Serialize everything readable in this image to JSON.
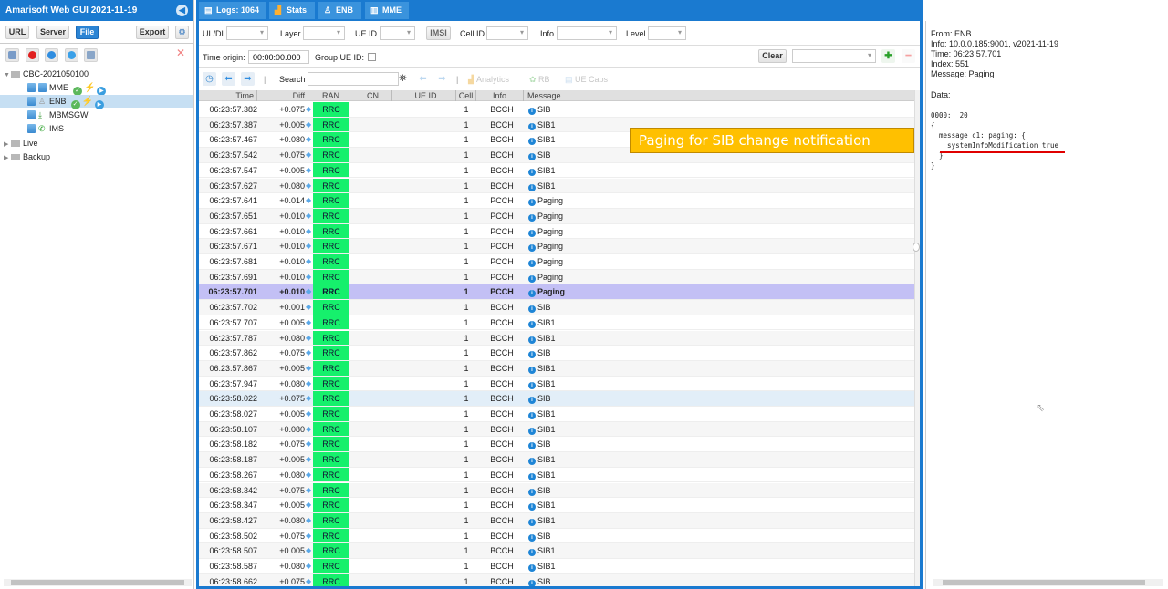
{
  "app": {
    "title": "Amarisoft Web GUI 2021-11-19"
  },
  "left_toolbar": {
    "url_label": "URL",
    "server_label": "Server",
    "file_label": "File",
    "export_label": "Export"
  },
  "tree": {
    "root": "CBC-2021050100",
    "children": [
      {
        "label": "MME",
        "status": "ok"
      },
      {
        "label": "ENB",
        "status": "ok",
        "selected": true
      },
      {
        "label": "MBMSGW"
      },
      {
        "label": "IMS"
      }
    ],
    "folders": [
      "Live",
      "Backup"
    ]
  },
  "tabs": [
    {
      "label": "Logs: 1064",
      "icon": "document-icon"
    },
    {
      "label": "Stats",
      "icon": "bar-chart-icon"
    },
    {
      "label": "ENB",
      "icon": "antenna-icon"
    },
    {
      "label": "MME",
      "icon": "server-icon"
    }
  ],
  "filters": {
    "uldl_label": "UL/DL",
    "layer_label": "Layer",
    "ueid_label": "UE ID",
    "imsi_label": "IMSI",
    "cellid_label": "Cell ID",
    "info_label": "Info",
    "level_label": "Level",
    "time_origin_label": "Time origin:",
    "time_origin_value": "00:00:00.000",
    "group_ueid_label": "Group UE ID:",
    "clear_label": "Clear"
  },
  "toolbar": {
    "search_label": "Search",
    "search_value": "",
    "analytics_label": "Analytics",
    "rb_label": "RB",
    "uecaps_label": "UE Caps"
  },
  "table": {
    "columns": [
      "Time",
      "Diff",
      "RAN",
      "CN",
      "UE ID",
      "Cell",
      "Info",
      "Message"
    ],
    "rows": [
      {
        "time": "06:23:57.382",
        "diff": "+0.075",
        "ran": "RRC",
        "cell": "1",
        "info": "BCCH",
        "msg": "SIB"
      },
      {
        "time": "06:23:57.387",
        "diff": "+0.005",
        "ran": "RRC",
        "cell": "1",
        "info": "BCCH",
        "msg": "SIB1"
      },
      {
        "time": "06:23:57.467",
        "diff": "+0.080",
        "ran": "RRC",
        "cell": "1",
        "info": "BCCH",
        "msg": "SIB1"
      },
      {
        "time": "06:23:57.542",
        "diff": "+0.075",
        "ran": "RRC",
        "cell": "1",
        "info": "BCCH",
        "msg": "SIB"
      },
      {
        "time": "06:23:57.547",
        "diff": "+0.005",
        "ran": "RRC",
        "cell": "1",
        "info": "BCCH",
        "msg": "SIB1"
      },
      {
        "time": "06:23:57.627",
        "diff": "+0.080",
        "ran": "RRC",
        "cell": "1",
        "info": "BCCH",
        "msg": "SIB1"
      },
      {
        "time": "06:23:57.641",
        "diff": "+0.014",
        "ran": "RRC",
        "cell": "1",
        "info": "PCCH",
        "msg": "Paging"
      },
      {
        "time": "06:23:57.651",
        "diff": "+0.010",
        "ran": "RRC",
        "cell": "1",
        "info": "PCCH",
        "msg": "Paging"
      },
      {
        "time": "06:23:57.661",
        "diff": "+0.010",
        "ran": "RRC",
        "cell": "1",
        "info": "PCCH",
        "msg": "Paging"
      },
      {
        "time": "06:23:57.671",
        "diff": "+0.010",
        "ran": "RRC",
        "cell": "1",
        "info": "PCCH",
        "msg": "Paging"
      },
      {
        "time": "06:23:57.681",
        "diff": "+0.010",
        "ran": "RRC",
        "cell": "1",
        "info": "PCCH",
        "msg": "Paging"
      },
      {
        "time": "06:23:57.691",
        "diff": "+0.010",
        "ran": "RRC",
        "cell": "1",
        "info": "PCCH",
        "msg": "Paging"
      },
      {
        "time": "06:23:57.701",
        "diff": "+0.010",
        "ran": "RRC",
        "cell": "1",
        "info": "PCCH",
        "msg": "Paging",
        "selected": true
      },
      {
        "time": "06:23:57.702",
        "diff": "+0.001",
        "ran": "RRC",
        "cell": "1",
        "info": "BCCH",
        "msg": "SIB"
      },
      {
        "time": "06:23:57.707",
        "diff": "+0.005",
        "ran": "RRC",
        "cell": "1",
        "info": "BCCH",
        "msg": "SIB1"
      },
      {
        "time": "06:23:57.787",
        "diff": "+0.080",
        "ran": "RRC",
        "cell": "1",
        "info": "BCCH",
        "msg": "SIB1"
      },
      {
        "time": "06:23:57.862",
        "diff": "+0.075",
        "ran": "RRC",
        "cell": "1",
        "info": "BCCH",
        "msg": "SIB"
      },
      {
        "time": "06:23:57.867",
        "diff": "+0.005",
        "ran": "RRC",
        "cell": "1",
        "info": "BCCH",
        "msg": "SIB1"
      },
      {
        "time": "06:23:57.947",
        "diff": "+0.080",
        "ran": "RRC",
        "cell": "1",
        "info": "BCCH",
        "msg": "SIB1"
      },
      {
        "time": "06:23:58.022",
        "diff": "+0.075",
        "ran": "RRC",
        "cell": "1",
        "info": "BCCH",
        "msg": "SIB",
        "hover": true
      },
      {
        "time": "06:23:58.027",
        "diff": "+0.005",
        "ran": "RRC",
        "cell": "1",
        "info": "BCCH",
        "msg": "SIB1"
      },
      {
        "time": "06:23:58.107",
        "diff": "+0.080",
        "ran": "RRC",
        "cell": "1",
        "info": "BCCH",
        "msg": "SIB1"
      },
      {
        "time": "06:23:58.182",
        "diff": "+0.075",
        "ran": "RRC",
        "cell": "1",
        "info": "BCCH",
        "msg": "SIB"
      },
      {
        "time": "06:23:58.187",
        "diff": "+0.005",
        "ran": "RRC",
        "cell": "1",
        "info": "BCCH",
        "msg": "SIB1"
      },
      {
        "time": "06:23:58.267",
        "diff": "+0.080",
        "ran": "RRC",
        "cell": "1",
        "info": "BCCH",
        "msg": "SIB1"
      },
      {
        "time": "06:23:58.342",
        "diff": "+0.075",
        "ran": "RRC",
        "cell": "1",
        "info": "BCCH",
        "msg": "SIB"
      },
      {
        "time": "06:23:58.347",
        "diff": "+0.005",
        "ran": "RRC",
        "cell": "1",
        "info": "BCCH",
        "msg": "SIB1"
      },
      {
        "time": "06:23:58.427",
        "diff": "+0.080",
        "ran": "RRC",
        "cell": "1",
        "info": "BCCH",
        "msg": "SIB1"
      },
      {
        "time": "06:23:58.502",
        "diff": "+0.075",
        "ran": "RRC",
        "cell": "1",
        "info": "BCCH",
        "msg": "SIB"
      },
      {
        "time": "06:23:58.507",
        "diff": "+0.005",
        "ran": "RRC",
        "cell": "1",
        "info": "BCCH",
        "msg": "SIB1"
      },
      {
        "time": "06:23:58.587",
        "diff": "+0.080",
        "ran": "RRC",
        "cell": "1",
        "info": "BCCH",
        "msg": "SIB1"
      },
      {
        "time": "06:23:58.662",
        "diff": "+0.075",
        "ran": "RRC",
        "cell": "1",
        "info": "BCCH",
        "msg": "SIB"
      }
    ]
  },
  "annotation": {
    "text": "Paging for SIB change notification"
  },
  "detail": {
    "from": "From: ENB",
    "info": "Info: 10.0.0.185:9001, v2021-11-19",
    "time": "Time: 06:23:57.701",
    "index": "Index: 551",
    "message": "Message: Paging",
    "data_label": "Data:",
    "hex": "0000:  20",
    "code": [
      "{",
      "  message c1: paging: {",
      "    systemInfoModification true",
      "  }",
      "}"
    ]
  },
  "colors": {
    "accent": "#1a7ad0",
    "ran_cell": "#16f06c",
    "selected_row": "#c3c0f5",
    "callout": "#ffc000"
  }
}
